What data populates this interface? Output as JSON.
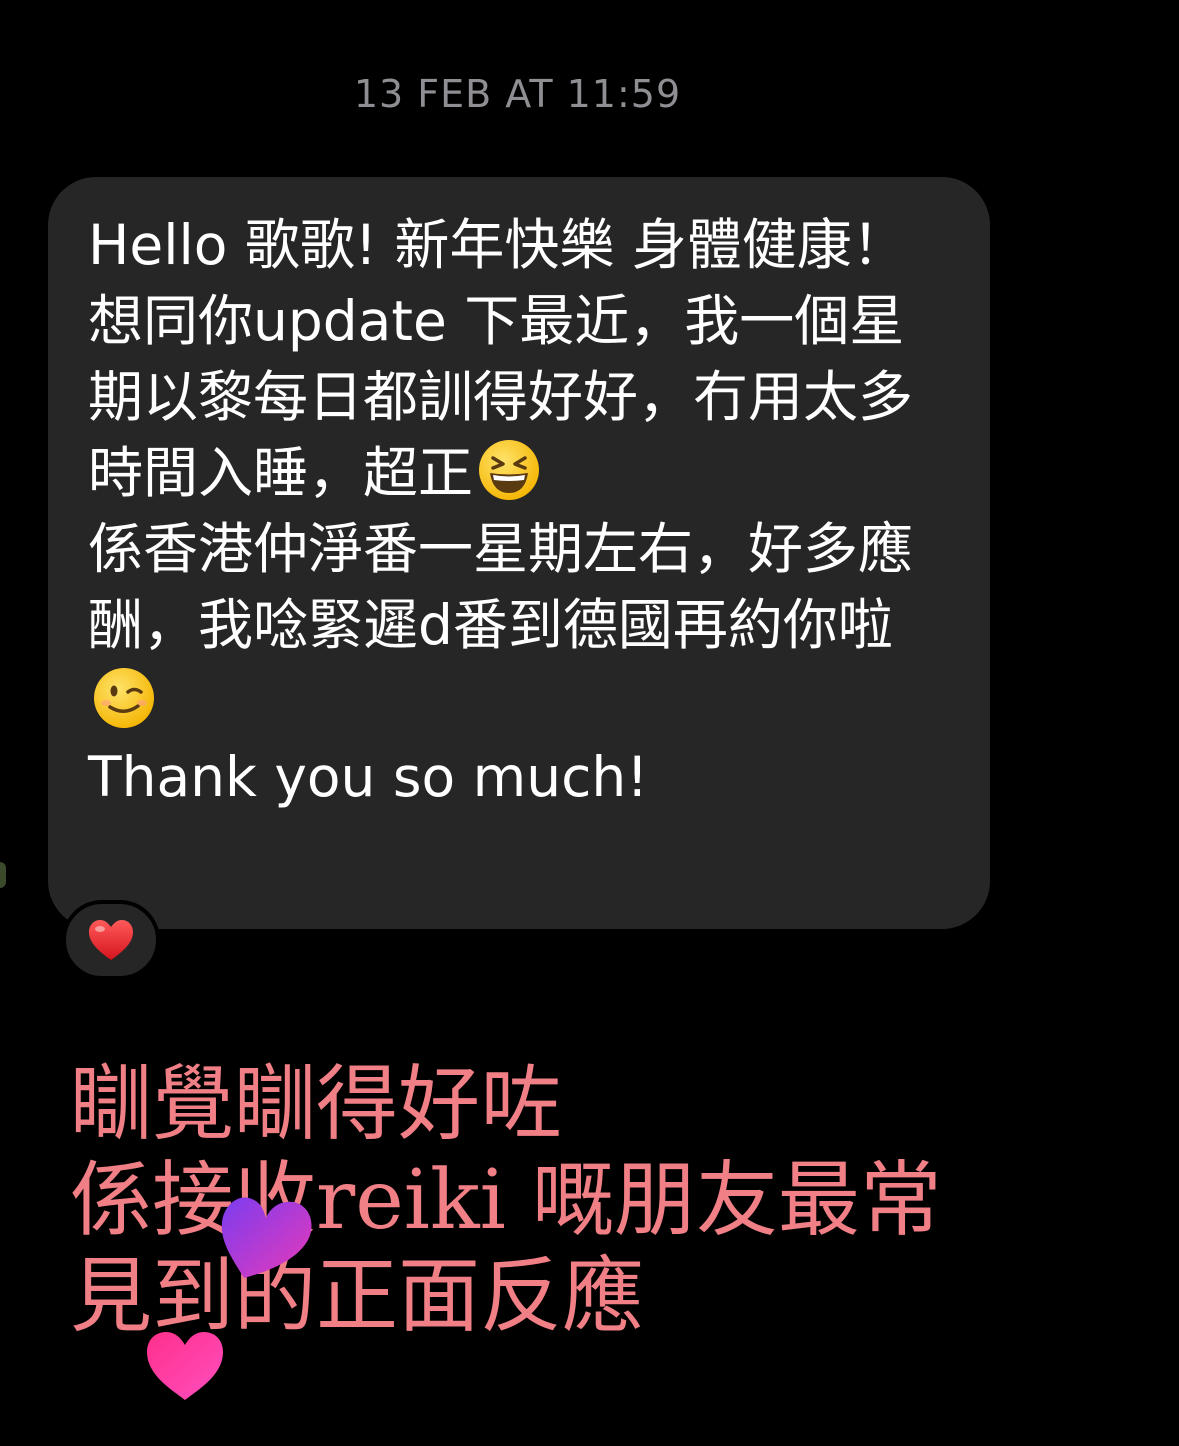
{
  "timestamp": "13 FEB AT 11:59",
  "message": {
    "lines": [
      "Hello 歌歌! 新年快樂 身體健康！",
      "想同你update 下最近，我一個星期以黎每日都訓得好好，冇用太多時間入睡，超正",
      "係香港仲淨番一星期左右，好多應酬，我唸緊遲d番到德國再約你啦",
      "Thank you so much!"
    ],
    "emojis": {
      "line2": "grinning-squinting-face-icon",
      "line3": "winking-face-icon"
    }
  },
  "reaction": {
    "icon": "red-heart-icon",
    "color": "#e8202b"
  },
  "overlay_text": {
    "lines": [
      "瞓覺瞓得好咗",
      "係接收reiki 嘅朋友最常",
      "見到的正面反應"
    ],
    "color": "#f07f86"
  },
  "stickers": [
    {
      "icon": "purple-heart-sticker-icon",
      "color_start": "#7b3cf0",
      "color_end": "#e83ab8"
    },
    {
      "icon": "pink-heart-sticker-icon",
      "color_start": "#ff2f8a",
      "color_end": "#ff4fc0"
    }
  ]
}
